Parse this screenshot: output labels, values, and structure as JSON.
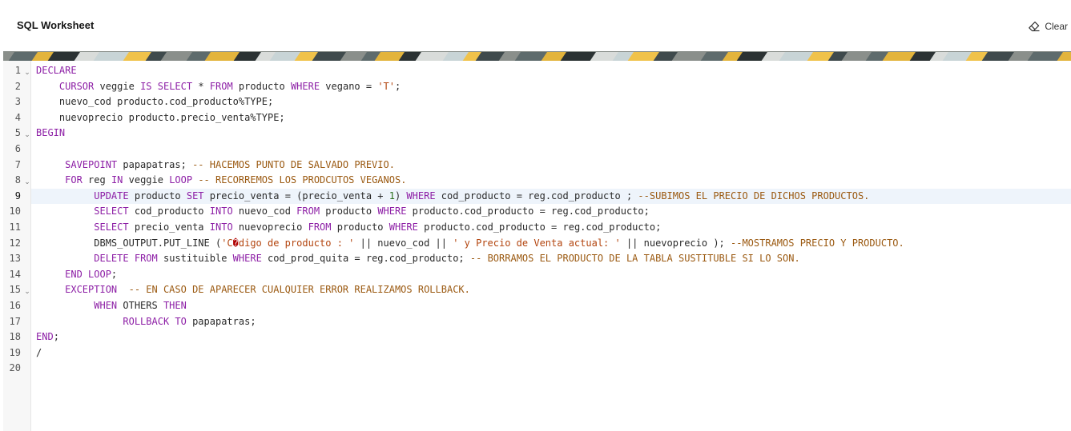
{
  "header": {
    "title": "SQL Worksheet",
    "clear_label": "Clear",
    "clear_icon": "eraser-icon"
  },
  "banner": {
    "colors": [
      "#8a8f8b",
      "#c8d4d6",
      "#e3b43c",
      "#3f4a4c",
      "#d9dcda",
      "#5e6b6c",
      "#f0c24a",
      "#2b3233"
    ]
  },
  "editor": {
    "active_line": 9,
    "fold_lines": [
      1,
      5,
      8,
      15
    ],
    "colors": {
      "keyword": "#8d1fa6",
      "string": "#b3450f",
      "comment": "#9b5a12",
      "number": "#2a6f1c",
      "active_line_bg": "#eef4fb"
    },
    "lines": [
      [
        [
          "kw",
          "DECLARE"
        ]
      ],
      [
        [
          "t",
          "    "
        ],
        [
          "kw",
          "CURSOR"
        ],
        [
          "t",
          " veggie "
        ],
        [
          "kw",
          "IS"
        ],
        [
          "t",
          " "
        ],
        [
          "kw",
          "SELECT"
        ],
        [
          "t",
          " * "
        ],
        [
          "kw",
          "FROM"
        ],
        [
          "t",
          " producto "
        ],
        [
          "kw",
          "WHERE"
        ],
        [
          "t",
          " vegano = "
        ],
        [
          "str",
          "'T'"
        ],
        [
          "t",
          ";"
        ]
      ],
      [
        [
          "t",
          "    nuevo_cod producto.cod_producto%TYPE;"
        ]
      ],
      [
        [
          "t",
          "    nuevoprecio producto.precio_venta%TYPE;"
        ]
      ],
      [
        [
          "kw",
          "BEGIN"
        ]
      ],
      [],
      [
        [
          "t",
          "     "
        ],
        [
          "kw",
          "SAVEPOINT"
        ],
        [
          "t",
          " papapatras; "
        ],
        [
          "cm",
          "-- HACEMOS PUNTO DE SALVADO PREVIO."
        ]
      ],
      [
        [
          "t",
          "     "
        ],
        [
          "kw",
          "FOR"
        ],
        [
          "t",
          " reg "
        ],
        [
          "kw",
          "IN"
        ],
        [
          "t",
          " veggie "
        ],
        [
          "kw",
          "LOOP"
        ],
        [
          "t",
          " "
        ],
        [
          "cm",
          "-- RECORREMOS LOS PRODCUTOS VEGANOS."
        ]
      ],
      [
        [
          "t",
          "          "
        ],
        [
          "kw",
          "UPDATE"
        ],
        [
          "t",
          " producto "
        ],
        [
          "kw",
          "SET"
        ],
        [
          "t",
          " precio_venta = (precio_venta + "
        ],
        [
          "num",
          "1"
        ],
        [
          "t",
          ") "
        ],
        [
          "kw",
          "WHERE"
        ],
        [
          "t",
          " cod_producto = reg.cod_producto ; "
        ],
        [
          "cm",
          "--SUBIMOS EL PRECIO DE DICHOS PRODUCTOS."
        ]
      ],
      [
        [
          "t",
          "          "
        ],
        [
          "kw",
          "SELECT"
        ],
        [
          "t",
          " cod_producto "
        ],
        [
          "kw",
          "INTO"
        ],
        [
          "t",
          " nuevo_cod "
        ],
        [
          "kw",
          "FROM"
        ],
        [
          "t",
          " producto "
        ],
        [
          "kw",
          "WHERE"
        ],
        [
          "t",
          " producto.cod_producto = reg.cod_producto;"
        ]
      ],
      [
        [
          "t",
          "          "
        ],
        [
          "kw",
          "SELECT"
        ],
        [
          "t",
          " precio_venta "
        ],
        [
          "kw",
          "INTO"
        ],
        [
          "t",
          " nuevoprecio "
        ],
        [
          "kw",
          "FROM"
        ],
        [
          "t",
          " producto "
        ],
        [
          "kw",
          "WHERE"
        ],
        [
          "t",
          " producto.cod_producto = reg.cod_producto;"
        ]
      ],
      [
        [
          "t",
          "          DBMS_OUTPUT.PUT_LINE ("
        ],
        [
          "str",
          "'C"
        ],
        [
          "bad",
          "�"
        ],
        [
          "str",
          "digo de producto : '"
        ],
        [
          "t",
          " || nuevo_cod || "
        ],
        [
          "str",
          "' y Precio de Venta actual: '"
        ],
        [
          "t",
          " || nuevoprecio ); "
        ],
        [
          "cm",
          "--MOSTRAMOS PRECIO Y PRODUCTO."
        ]
      ],
      [
        [
          "t",
          "          "
        ],
        [
          "kw",
          "DELETE"
        ],
        [
          "t",
          " "
        ],
        [
          "kw",
          "FROM"
        ],
        [
          "t",
          " sustituible "
        ],
        [
          "kw",
          "WHERE"
        ],
        [
          "t",
          " cod_prod_quita = reg.cod_producto; "
        ],
        [
          "cm",
          "-- BORRAMOS EL PRODUCTO DE LA TABLA SUSTITUBLE SI LO SON."
        ]
      ],
      [
        [
          "t",
          "     "
        ],
        [
          "kw",
          "END LOOP"
        ],
        [
          "t",
          ";"
        ]
      ],
      [
        [
          "t",
          "     "
        ],
        [
          "kw",
          "EXCEPTION"
        ],
        [
          "t",
          "  "
        ],
        [
          "cm",
          "-- EN CASO DE APARECER CUALQUIER ERROR REALIZAMOS ROLLBACK."
        ]
      ],
      [
        [
          "t",
          "          "
        ],
        [
          "kw",
          "WHEN"
        ],
        [
          "t",
          " OTHERS "
        ],
        [
          "kw",
          "THEN"
        ]
      ],
      [
        [
          "t",
          "               "
        ],
        [
          "kw",
          "ROLLBACK"
        ],
        [
          "t",
          " "
        ],
        [
          "kw",
          "TO"
        ],
        [
          "t",
          " papapatras;"
        ]
      ],
      [
        [
          "kw",
          "END"
        ],
        [
          "t",
          ";"
        ]
      ],
      [
        [
          "t",
          "/"
        ]
      ],
      []
    ]
  }
}
